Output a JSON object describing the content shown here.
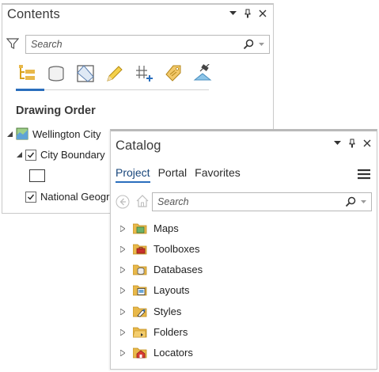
{
  "contents": {
    "title": "Contents",
    "search_placeholder": "Search",
    "section_heading": "Drawing Order",
    "tree": {
      "map_name": "Wellington City",
      "layer_1": "City Boundary",
      "layer_2": "National Geogr"
    },
    "tools": [
      "list-by-drawing-order",
      "list-by-data-source",
      "list-by-selection",
      "list-by-editing",
      "list-by-snapping",
      "list-by-labeling",
      "list-by-perspective-imagery"
    ]
  },
  "catalog": {
    "title": "Catalog",
    "tabs": [
      "Project",
      "Portal",
      "Favorites"
    ],
    "active_tab": "Project",
    "search_placeholder": "Search",
    "items": [
      {
        "label": "Maps",
        "icon": "maps-folder-icon"
      },
      {
        "label": "Toolboxes",
        "icon": "toolboxes-folder-icon"
      },
      {
        "label": "Databases",
        "icon": "databases-folder-icon"
      },
      {
        "label": "Layouts",
        "icon": "layouts-folder-icon"
      },
      {
        "label": "Styles",
        "icon": "styles-folder-icon"
      },
      {
        "label": "Folders",
        "icon": "folders-folder-icon"
      },
      {
        "label": "Locators",
        "icon": "locators-folder-icon"
      }
    ]
  },
  "colors": {
    "accent": "#2a6ebd",
    "folder_yellow": "#e8b84a",
    "border": "#c9c9c9"
  }
}
